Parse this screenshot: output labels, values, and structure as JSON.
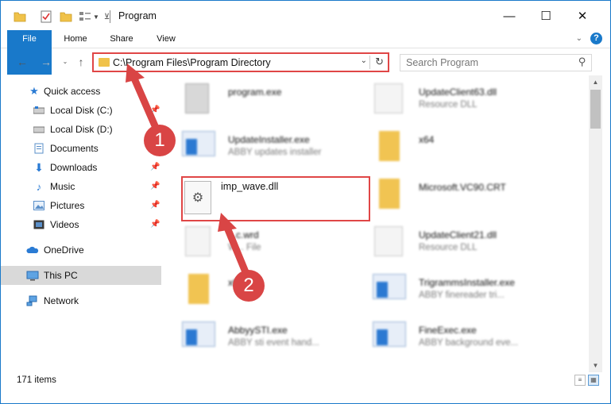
{
  "window": {
    "title": "Program"
  },
  "title_buttons": {
    "minimize": "—",
    "maximize": "☐",
    "close": "✕"
  },
  "ribbon": {
    "tabs": [
      "File",
      "Home",
      "Share",
      "View"
    ],
    "help": "?"
  },
  "address": {
    "path": "C:\\Program Files\\Program Directory"
  },
  "search": {
    "placeholder": "Search Program"
  },
  "sidebar": {
    "items": [
      {
        "label": "Quick access",
        "icon": "star-icon"
      },
      {
        "label": "Local Disk (C:)",
        "icon": "drive-icon"
      },
      {
        "label": "Local Disk (D:)",
        "icon": "drive-icon"
      },
      {
        "label": "Documents",
        "icon": "documents-icon"
      },
      {
        "label": "Downloads",
        "icon": "downloads-icon"
      },
      {
        "label": "Music",
        "icon": "music-icon"
      },
      {
        "label": "Pictures",
        "icon": "pictures-icon"
      },
      {
        "label": "Videos",
        "icon": "videos-icon"
      },
      {
        "label": "OneDrive",
        "icon": "cloud-icon"
      },
      {
        "label": "This PC",
        "icon": "computer-icon"
      },
      {
        "label": "Network",
        "icon": "network-icon"
      }
    ]
  },
  "files": [
    {
      "name": "program.exe",
      "desc": ""
    },
    {
      "name": "UpdateClient63.dll",
      "desc": "Resource DLL"
    },
    {
      "name": "UpdateInstaller.exe",
      "desc": "ABBY updates installer"
    },
    {
      "name": "x64",
      "desc": ""
    },
    {
      "name": "imp_wave.dll",
      "desc": ""
    },
    {
      "name": "Microsoft.VC90.CRT",
      "desc": ""
    },
    {
      "name": "...c.wrd",
      "desc": "W... File"
    },
    {
      "name": "UpdateClient21.dll",
      "desc": "Resource DLL"
    },
    {
      "name": "x64",
      "desc": ""
    },
    {
      "name": "TrigrammsInstaller.exe",
      "desc": "ABBY finereader tri..."
    },
    {
      "name": "AbbyySTI.exe",
      "desc": "ABBY sti event hand..."
    },
    {
      "name": "FineExec.exe",
      "desc": "ABBY background eve..."
    }
  ],
  "status": {
    "count": "171 items"
  },
  "annotations": {
    "step1": "1",
    "step2": "2"
  },
  "colors": {
    "accent": "#1979ca",
    "highlight": "#e04646",
    "callout": "#d94545"
  }
}
